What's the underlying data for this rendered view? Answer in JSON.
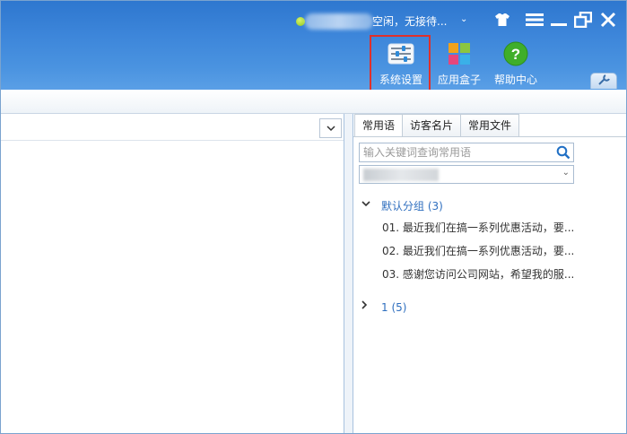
{
  "header": {
    "status_text": "空闲，无接待...",
    "status_dropdown_icon": "chevron-down-icon",
    "window_controls": [
      "skin-icon",
      "menu-icon",
      "minimize-icon",
      "restore-icon",
      "close-icon"
    ]
  },
  "toolbar": {
    "items": [
      {
        "label": "系统设置",
        "icon": "settings-sliders-icon",
        "highlighted": true
      },
      {
        "label": "应用盒子",
        "icon": "app-grid-icon"
      },
      {
        "label": "帮助中心",
        "icon": "help-icon"
      }
    ],
    "highlight_color": "#e0302a"
  },
  "right_panel": {
    "tabs": [
      {
        "label": "常用语",
        "active": true
      },
      {
        "label": "访客名片",
        "active": false
      },
      {
        "label": "常用文件",
        "active": false
      }
    ],
    "search": {
      "placeholder": "输入关键词查询常用语",
      "value": ""
    },
    "groups": [
      {
        "name": "默认分组 (3)",
        "expanded": true,
        "items": [
          "01. 最近我们在搞一系列优惠活动，要...",
          "02. 最近我们在搞一系列优惠活动，要...",
          "03. 感谢您访问公司网站，希望我的服..."
        ]
      },
      {
        "name": "1 (5)",
        "expanded": false,
        "items": []
      }
    ]
  },
  "colors": {
    "titlebar": "#3d86da",
    "accent_text": "#2f6fbf",
    "border": "#a8c2df"
  }
}
